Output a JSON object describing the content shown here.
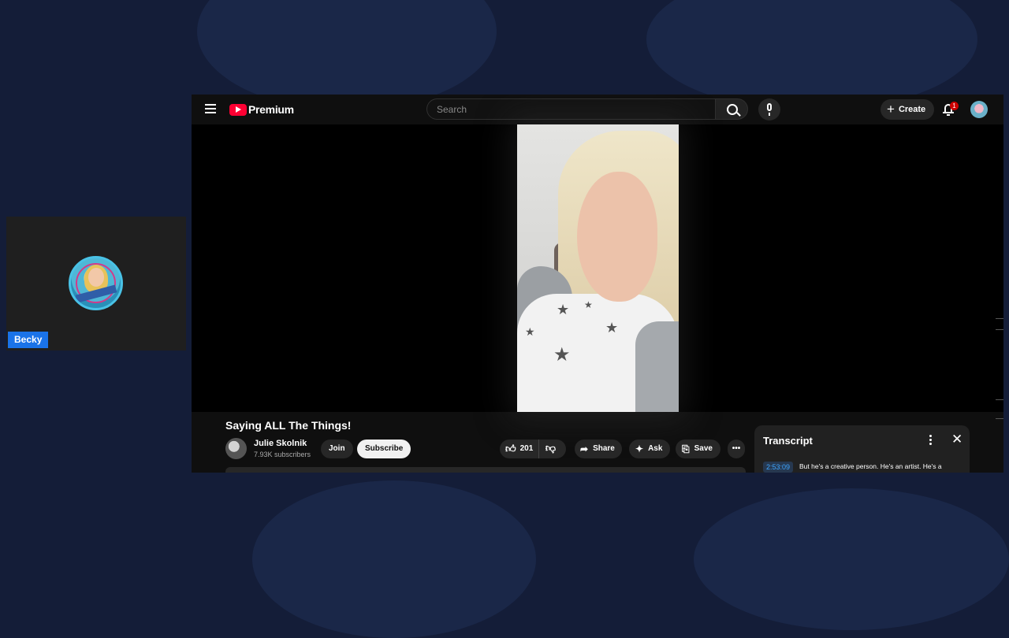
{
  "participant": {
    "name": "Becky"
  },
  "header": {
    "logo_text": "Premium",
    "search_placeholder": "Search",
    "create_label": "Create",
    "notification_count": "1"
  },
  "video": {
    "title": "Saying ALL The Things!",
    "channel_name": "Julie Skolnik",
    "subscribers": "7.93K subscribers",
    "join_label": "Join",
    "subscribe_label": "Subscribe",
    "likes": "201",
    "share_label": "Share",
    "ask_label": "Ask",
    "save_label": "Save"
  },
  "transcript": {
    "title": "Transcript",
    "entries": [
      {
        "timestamp": "2:53:09",
        "text": "But he's a creative person. He's an artist. He's a"
      }
    ]
  },
  "icons": {
    "menu": "hamburger-menu-icon",
    "search": "search-icon",
    "mic": "microphone-icon",
    "bell": "bell-icon",
    "like": "thumbs-up-icon",
    "dislike": "thumbs-down-icon",
    "share": "share-arrow-icon",
    "ask": "sparkle-icon",
    "save": "bookmark-icon",
    "more": "more-horizontal-icon",
    "close": "close-icon"
  },
  "colors": {
    "background": "#141d38",
    "youtube_red": "#ff0033",
    "name_tag": "#1a73e8",
    "timestamp_link": "#3ea6ff"
  }
}
